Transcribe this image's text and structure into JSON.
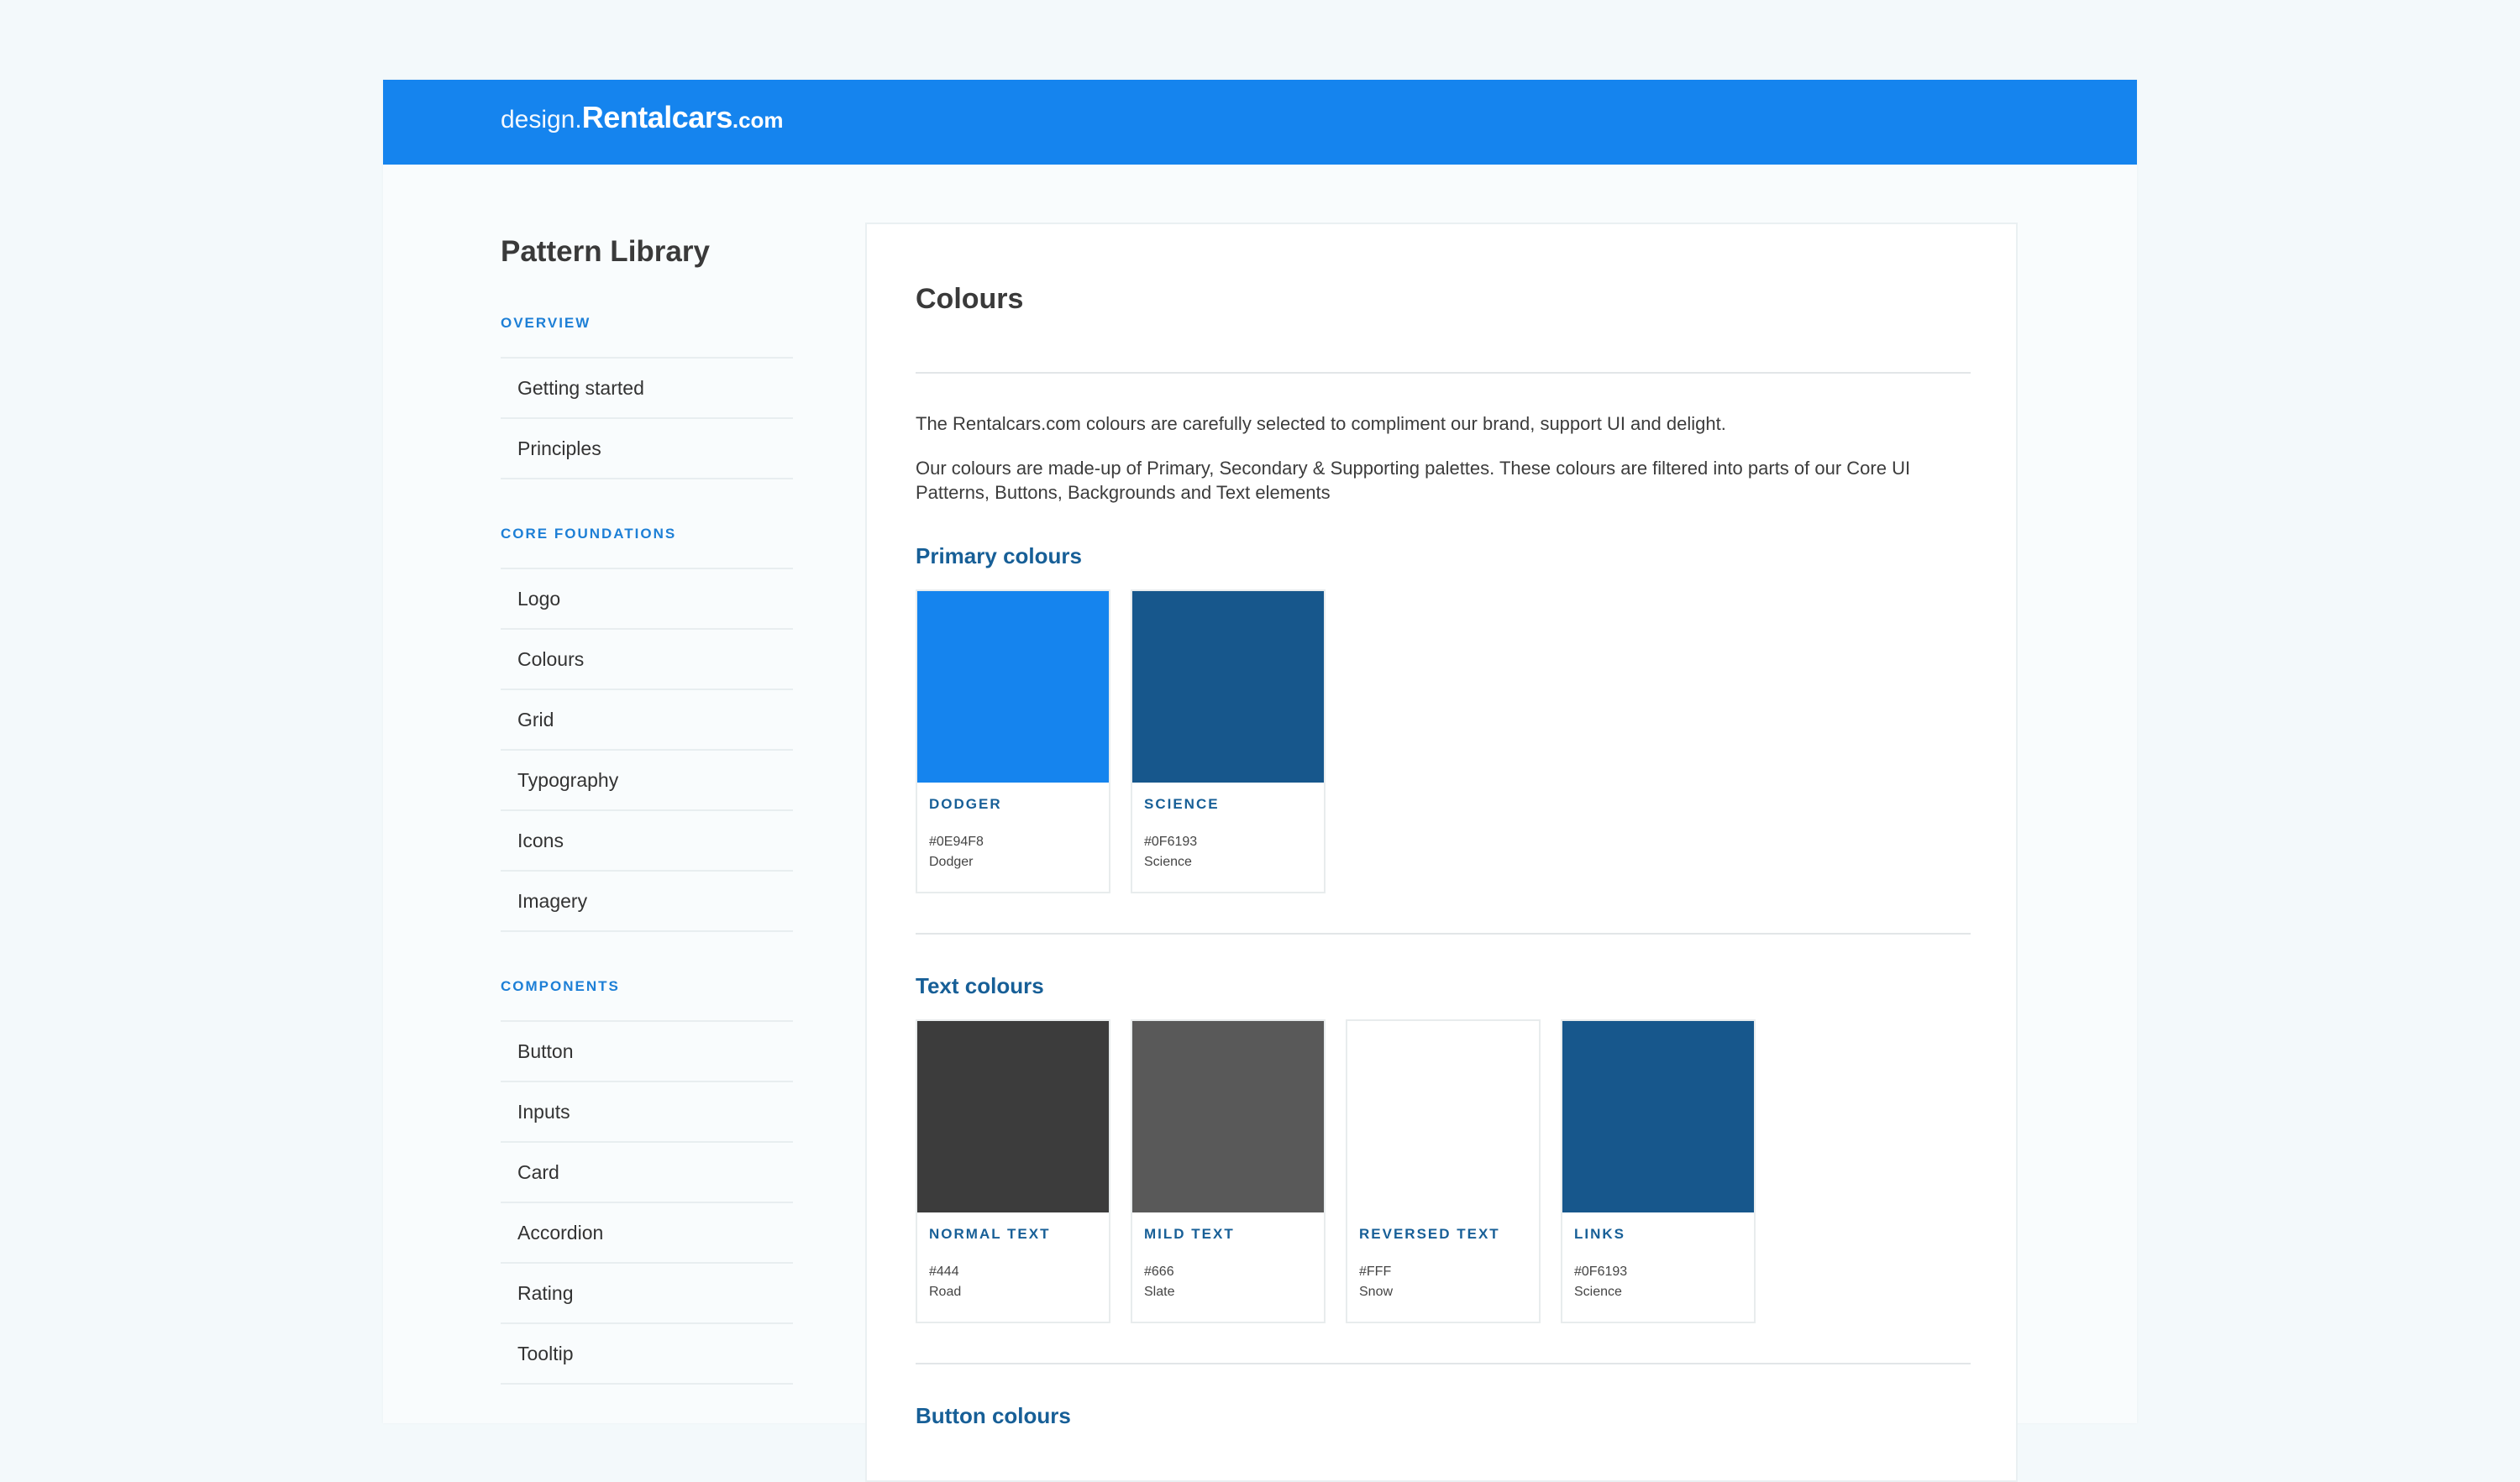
{
  "header": {
    "logo_prefix": "design.",
    "logo_main": "Rentalcars",
    "logo_suffix": ".com",
    "background": "#1584EE"
  },
  "sidebar": {
    "title": "Pattern Library",
    "sections": [
      {
        "title": "OVERVIEW",
        "items": [
          "Getting started",
          "Principles"
        ]
      },
      {
        "title": "CORE FOUNDATIONS",
        "items": [
          "Logo",
          "Colours",
          "Grid",
          "Typography",
          "Icons",
          "Imagery"
        ]
      },
      {
        "title": "COMPONENTS",
        "items": [
          "Button",
          "Inputs",
          "Card",
          "Accordion",
          "Rating",
          "Tooltip"
        ]
      }
    ]
  },
  "main": {
    "title": "Colours",
    "intro_1": "The Rentalcars.com colours are carefully selected to compliment our brand, support UI and delight.",
    "intro_2": "Our colours are made-up of Primary, Secondary & Supporting palettes. These colours are filtered into parts of our Core UI Patterns, Buttons, Backgrounds and Text elements",
    "primary": {
      "heading": "Primary colours",
      "swatches": [
        {
          "name": "DODGER",
          "hex": "#0E94F8",
          "label": "Dodger",
          "color": "#1584EE"
        },
        {
          "name": "SCIENCE",
          "hex": "#0F6193",
          "label": "Science",
          "color": "#17578C"
        }
      ]
    },
    "text": {
      "heading": "Text colours",
      "swatches": [
        {
          "name": "NORMAL TEXT",
          "hex": "#444",
          "label": "Road",
          "color": "#3C3C3C"
        },
        {
          "name": "MILD TEXT",
          "hex": "#666",
          "label": "Slate",
          "color": "#595959"
        },
        {
          "name": "REVERSED TEXT",
          "hex": "#FFF",
          "label": "Snow",
          "color": "#FFFFFF"
        },
        {
          "name": "LINKS",
          "hex": "#0F6193",
          "label": "Science",
          "color": "#17578C"
        }
      ]
    },
    "button": {
      "heading": "Button colours"
    }
  }
}
